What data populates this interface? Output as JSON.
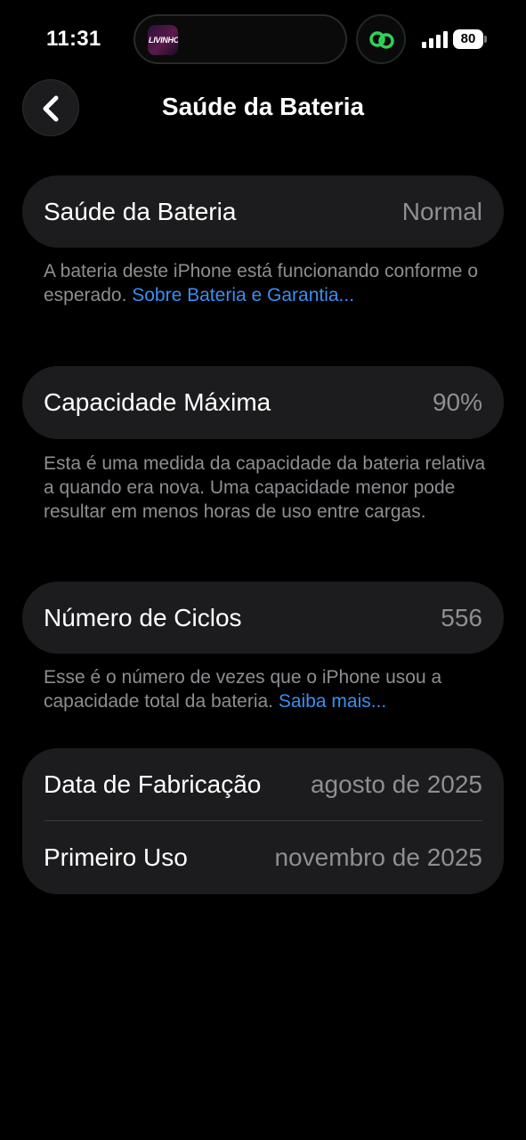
{
  "status_bar": {
    "time": "11:31",
    "battery_level": "80",
    "island_app_text": "LIVINHO",
    "icons": [
      "signal-icon",
      "battery-icon",
      "link-icon"
    ]
  },
  "nav": {
    "title": "Saúde da Bateria",
    "back_icon": "chevron-left-icon"
  },
  "battery_health": {
    "label": "Saúde da Bateria",
    "value": "Normal",
    "description": "A bateria deste iPhone está funcionando conforme o esperado.",
    "link": "Sobre Bateria e Garantia..."
  },
  "max_capacity": {
    "label": "Capacidade Máxima",
    "value": "90%",
    "description": "Esta é uma medida da capacidade da bateria relativa a quando era nova. Uma capacidade menor pode resultar em menos horas de uso entre cargas."
  },
  "cycle_count": {
    "label": "Número de Ciclos",
    "value": "556",
    "description": "Esse é o número de vezes que o iPhone usou a capacidade total da bateria.",
    "link": "Saiba mais..."
  },
  "dates": {
    "manufacture_label": "Data de Fabricação",
    "manufacture_value": "agosto de 2025",
    "first_use_label": "Primeiro Uso",
    "first_use_value": "novembro de 2025"
  },
  "colors": {
    "background": "#000000",
    "card": "#1c1c1e",
    "secondary_text": "#8e8e93",
    "link": "#3b8ef0",
    "accent_green": "#30d158"
  }
}
